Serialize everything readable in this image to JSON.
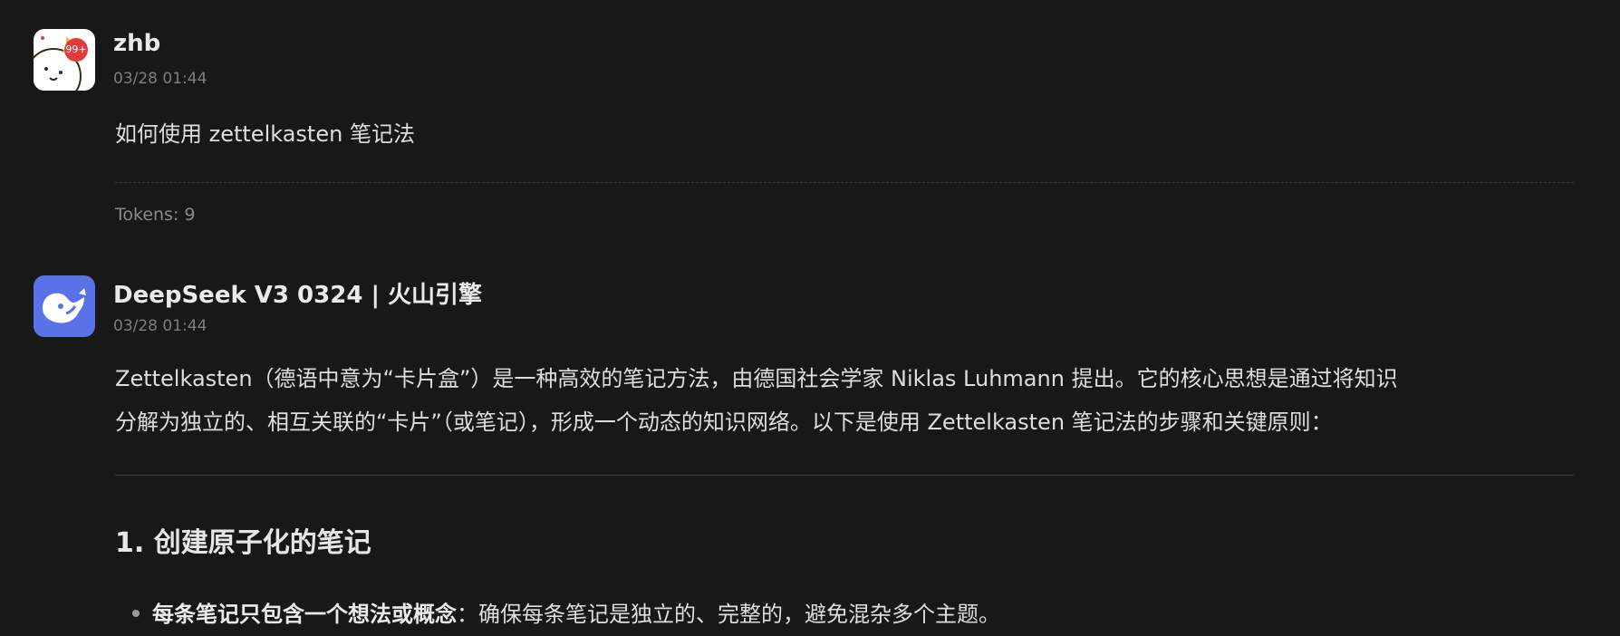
{
  "messages": {
    "user": {
      "name": "zhb",
      "time": "03/28 01:44",
      "avatar_badge": "99+",
      "avatar_icon": "cartoon-avatar-icon",
      "text": "如何使用 zettelkasten 笔记法",
      "tokens": "Tokens: 9"
    },
    "assistant": {
      "name": "DeepSeek V3 0324 | 火山引擎",
      "time": "03/28 01:44",
      "avatar_icon": "deepseek-whale-icon",
      "intro_line1": "Zettelkasten（德语中意为“卡片盒”）是一种高效的笔记方法，由德国社会学家 Niklas Luhmann 提出。它的核心思想是通过将知识",
      "intro_line2": "分解为独立的、相互关联的“卡片”（或笔记），形成一个动态的知识网络。以下是使用 Zettelkasten 笔记法的步骤和关键原则：",
      "section_heading": "1. 创建原子化的笔记",
      "bullet_bold": "每条笔记只包含一个想法或概念",
      "bullet_rest": "：确保每条笔记是独立的、完整的，避免混杂多个主题。"
    }
  },
  "colors": {
    "background": "#181818",
    "assistant_avatar": "#5a72e8",
    "badge": "#e23b3b"
  }
}
